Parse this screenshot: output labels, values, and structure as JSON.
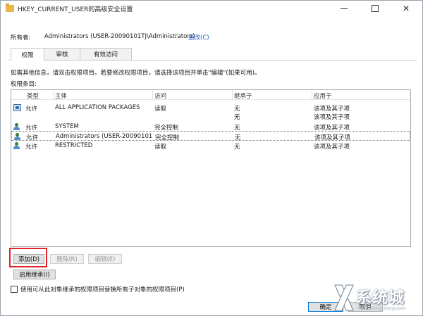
{
  "window": {
    "title": "HKEY_CURRENT_USER的高级安全设置"
  },
  "owner": {
    "label": "所有者:",
    "value": "Administrators (USER-20090101TJ\\Administrators)",
    "change_link": "更改(C)"
  },
  "tabs": [
    {
      "label": "权限",
      "active": true
    },
    {
      "label": "审核",
      "active": false
    },
    {
      "label": "有效访问",
      "active": false
    }
  ],
  "info_text": "如需其他信息，请双击权限项目。若要修改权限项目，请选择该项目并单击\"编辑\"(如果可用)。",
  "entries_label": "权限条目:",
  "table": {
    "columns": [
      "类型",
      "主体",
      "访问",
      "继承于",
      "应用于"
    ],
    "rows": [
      {
        "type": "允许",
        "principal": "ALL APPLICATION PACKAGES",
        "access": "读取",
        "inherited": "无",
        "applies": "该项及其子项",
        "icon": "package-icon",
        "selected": false
      },
      {
        "type": "",
        "principal": "",
        "access": "",
        "inherited": "无",
        "applies": "该项及其子项",
        "icon": "",
        "selected": false
      },
      {
        "type": "允许",
        "principal": "SYSTEM",
        "access": "完全控制",
        "inherited": "无",
        "applies": "该项及其子项",
        "icon": "user-icon",
        "selected": false
      },
      {
        "type": "允许",
        "principal": "Administrators (USER-20090101...",
        "access": "完全控制",
        "inherited": "无",
        "applies": "该项及其子项",
        "icon": "user-icon",
        "selected": true
      },
      {
        "type": "允许",
        "principal": "RESTRICTED",
        "access": "读取",
        "inherited": "无",
        "applies": "该项及其子项",
        "icon": "user-icon",
        "selected": false
      }
    ]
  },
  "buttons": {
    "add": "添加(D)",
    "remove": "删除(R)",
    "edit": "编辑(E)",
    "enable_inheritance": "启用继承(I)",
    "ok": "确定",
    "cancel": "取消"
  },
  "replace_checkbox": {
    "label": "使用可从此对象继承的权限项目替换所有子对象的权限项目(P)",
    "checked": false
  },
  "watermark": {
    "text": "系统城",
    "sub": "www.xitongcheng.com"
  },
  "colors": {
    "highlight": "#e0242a",
    "link": "#1a64c8"
  }
}
